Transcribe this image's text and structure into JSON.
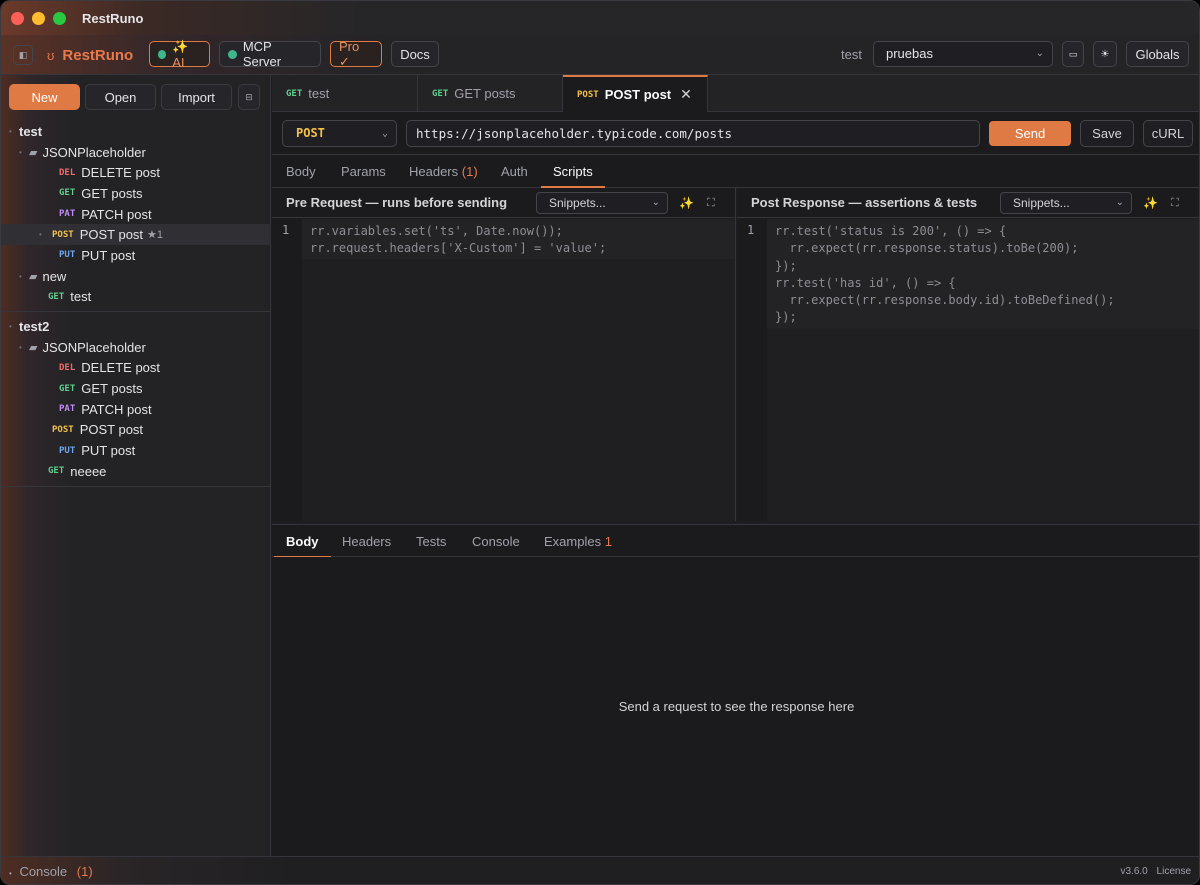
{
  "window": {
    "title": "RestRuno"
  },
  "toolbar": {
    "brand": "RestRuno",
    "ai_label": "✨ AI",
    "mcp_label": "MCP Server",
    "pro_label": "Pro ✓",
    "docs_label": "Docs",
    "env_label": "test",
    "env_value": "pruebas",
    "globals_label": "Globals"
  },
  "sidebar": {
    "new_label": "New",
    "open_label": "Open",
    "import_label": "Import",
    "collections": [
      {
        "name": "test",
        "folders": [
          {
            "name": "JSONPlaceholder",
            "requests": [
              {
                "method": "DEL",
                "name": "DELETE post"
              },
              {
                "method": "GET",
                "name": "GET posts"
              },
              {
                "method": "PAT",
                "name": "PATCH post"
              },
              {
                "method": "POST",
                "name": "POST post",
                "badge": "★1"
              },
              {
                "method": "PUT",
                "name": "PUT post"
              }
            ]
          },
          {
            "name": "new",
            "requests": [
              {
                "method": "GET",
                "name": "test"
              }
            ]
          }
        ]
      },
      {
        "name": "test2",
        "folders": [
          {
            "name": "JSONPlaceholder",
            "requests": [
              {
                "method": "DEL",
                "name": "DELETE post"
              },
              {
                "method": "GET",
                "name": "GET posts"
              },
              {
                "method": "PAT",
                "name": "PATCH post"
              },
              {
                "method": "POST",
                "name": "POST post"
              },
              {
                "method": "PUT",
                "name": "PUT post"
              }
            ]
          }
        ],
        "requests": [
          {
            "method": "GET",
            "name": "neeee"
          }
        ]
      }
    ]
  },
  "tabs": [
    {
      "method": "GET",
      "name": "test"
    },
    {
      "method": "GET",
      "name": "GET posts"
    },
    {
      "method": "POST",
      "name": "POST post",
      "close": "✕"
    }
  ],
  "request": {
    "method": "POST",
    "url": "https://jsonplaceholder.typicode.com/posts",
    "send_label": "Send",
    "save_label": "Save",
    "curl_label": "cURL",
    "tabs": {
      "body": "Body",
      "params": "Params",
      "headers": "Headers",
      "headers_count": "(1)",
      "auth": "Auth",
      "scripts": "Scripts"
    }
  },
  "scripts": {
    "pre": {
      "title": "Pre Request — runs before sending",
      "snippets": "Snippets...",
      "line_number": "1",
      "code": "rr.variables.set('ts', Date.now());\nrr.request.headers['X-Custom'] = 'value';"
    },
    "post": {
      "title": "Post Response — assertions & tests",
      "snippets": "Snippets...",
      "line_number": "1",
      "code": "rr.test('status is 200', () => {\n  rr.expect(rr.response.status).toBe(200);\n});\nrr.test('has id', () => {\n  rr.expect(rr.response.body.id).toBeDefined();\n});"
    }
  },
  "response": {
    "tabs": {
      "body": "Body",
      "headers": "Headers",
      "tests": "Tests",
      "console": "Console",
      "examples": "Examples",
      "examples_count": "1"
    },
    "empty_message": "Send a request to see the response here"
  },
  "status": {
    "console_label": "Console",
    "console_count": "(1)",
    "version": "v3.6.0",
    "license": "License"
  },
  "colors": {
    "accent": "#e07a45",
    "del": "#ef6b6b",
    "get": "#5fce8b",
    "patch": "#c08bf5",
    "post": "#f5c04a",
    "put": "#6ca7f0"
  },
  "icons": {
    "sidebar_toggle": "sidebar-toggle-icon",
    "brand": "bear-icon",
    "theme": "sun-icon",
    "save_env": "save-icon",
    "magic": "sparkle-icon",
    "expand": "expand-icon",
    "collapse": "collapse-icon"
  }
}
